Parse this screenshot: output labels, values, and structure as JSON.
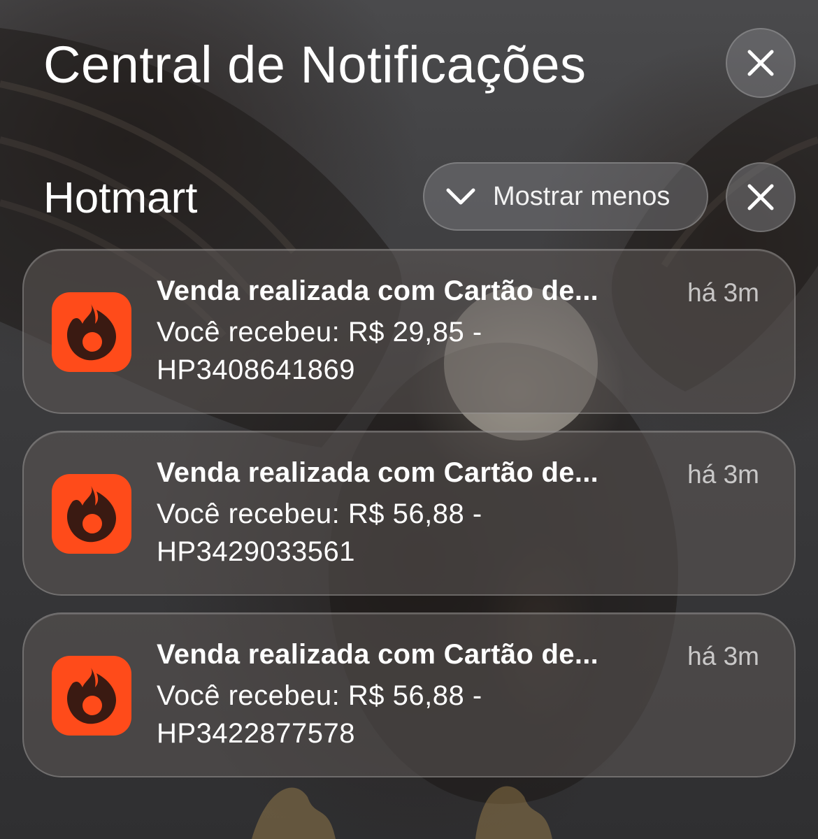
{
  "header": {
    "title": "Central de Notificações",
    "close_icon": "close-icon"
  },
  "group": {
    "app_name": "Hotmart",
    "toggle_label": "Mostrar menos",
    "toggle_icon": "chevron-down-icon",
    "close_icon": "close-icon"
  },
  "notifications": [
    {
      "title": "Venda realizada com Cartão de...",
      "time": "há 3m",
      "body": "Você recebeu: R$ 29,85 - HP3408641869",
      "icon": "hotmart-flame-icon"
    },
    {
      "title": "Venda realizada com Cartão de...",
      "time": "há 3m",
      "body": "Você recebeu: R$ 56,88 - HP3429033561",
      "icon": "hotmart-flame-icon"
    },
    {
      "title": "Venda realizada com Cartão de...",
      "time": "há 3m",
      "body": "Você recebeu: R$ 56,88 - HP3422877578",
      "icon": "hotmart-flame-icon"
    }
  ],
  "colors": {
    "app_icon": "#ff4b1a",
    "flame": "#3a1a12"
  }
}
